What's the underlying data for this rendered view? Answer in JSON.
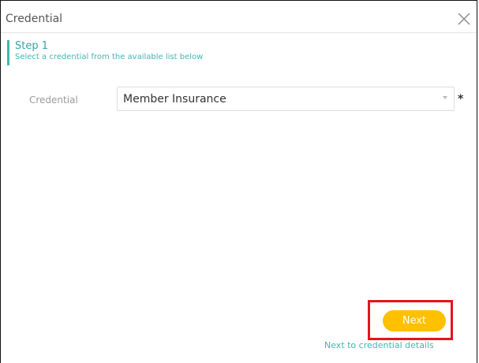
{
  "dialog": {
    "title": "Credential",
    "close_icon": "close-icon"
  },
  "step": {
    "title": "Step 1",
    "subtitle": "Select a credential from the available list below"
  },
  "form": {
    "credential_label": "Credential",
    "credential_value": "Member Insurance",
    "required_marker": "*"
  },
  "footer": {
    "next_label": "Next",
    "next_caption": "Next to credential details"
  },
  "colors": {
    "accent": "#3fb7b3",
    "button": "#ffc000",
    "highlight": "#e0161c"
  }
}
